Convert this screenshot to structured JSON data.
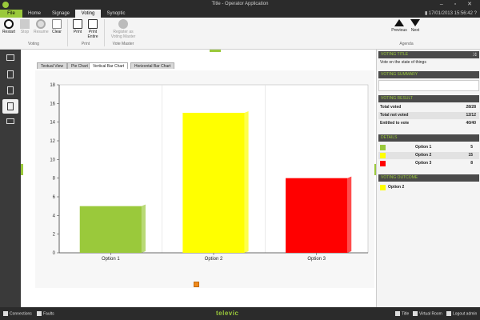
{
  "window": {
    "title": "Title - Operator Application"
  },
  "status_top": {
    "datetime": "17/01/2013 15:56:42"
  },
  "ribbon_tabs": [
    "File",
    "Home",
    "Signage",
    "Voting",
    "Synoptic"
  ],
  "ribbon": {
    "voting_group": {
      "label": "Voting",
      "buttons": [
        "Restart",
        "Stop",
        "Resume",
        "Clear"
      ]
    },
    "print_group": {
      "label": "Print",
      "buttons": [
        "Print",
        "Print Entire"
      ]
    },
    "vote_master_group": {
      "label": "Vote Master",
      "buttons": [
        "Register as Voting Master"
      ]
    },
    "agenda_group": {
      "label": "Agenda",
      "buttons": [
        "Previous",
        "Next"
      ]
    }
  },
  "content_tabs": [
    "Textual View",
    "Pie Chart",
    "Vertical Bar Chart",
    "Horizontal Bar Chart"
  ],
  "chart_data": {
    "type": "bar",
    "categories": [
      "Option 1",
      "Option 2",
      "Option 3"
    ],
    "values": [
      5,
      15,
      8
    ],
    "colors": [
      "#9ac93b",
      "#ffff00",
      "#ff0000"
    ],
    "ylim": [
      0,
      18
    ],
    "yticks": [
      0,
      2,
      4,
      6,
      8,
      10,
      12,
      14,
      16,
      18
    ],
    "grid": true
  },
  "right_panel": {
    "voting_title": {
      "header": "VOTING TITLE",
      "text": "Vote on the state of things"
    },
    "voting_summary": {
      "header": "VOTING SUMMARY"
    },
    "voting_result": {
      "header": "VOTING RESULT",
      "rows": [
        {
          "label": "Total voted",
          "value": "28/28"
        },
        {
          "label": "Total not voted",
          "value": "12/12"
        },
        {
          "label": "Entitled to vote",
          "value": "40/40"
        }
      ]
    },
    "details": {
      "header": "DETAILS",
      "rows": [
        {
          "label": "Option 1",
          "value": "5",
          "color": "#9ac93b"
        },
        {
          "label": "Option 2",
          "value": "15",
          "color": "#ffff00"
        },
        {
          "label": "Option 3",
          "value": "8",
          "color": "#ff0000"
        }
      ]
    },
    "voting_outcome": {
      "header": "VOTING OUTCOME",
      "value": "Option 2",
      "color": "#ffff00"
    }
  },
  "statusbar": {
    "connections": "Connections",
    "faults": "Faults",
    "brand": "televic",
    "title": "Title",
    "room": "Virtual Room",
    "logout": "Logout admin"
  },
  "colors": {
    "accent": "#9ac93b",
    "dark": "#2b2b2b"
  }
}
